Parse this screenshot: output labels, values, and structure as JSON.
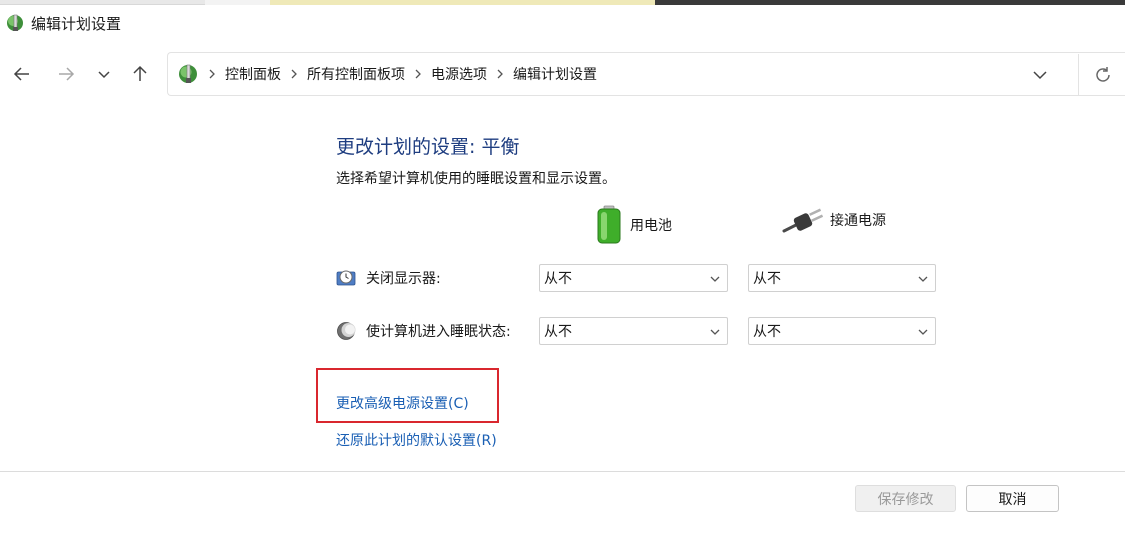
{
  "window": {
    "title": "编辑计划设置",
    "icon": "power-options-icon"
  },
  "nav": {
    "back_icon": "arrow-left-icon",
    "forward_icon": "arrow-right-icon",
    "recent_icon": "chevron-down-icon",
    "up_icon": "arrow-up-icon"
  },
  "breadcrumb": {
    "items": [
      "控制面板",
      "所有控制面板项",
      "电源选项",
      "编辑计划设置"
    ]
  },
  "main": {
    "heading": "更改计划的设置: 平衡",
    "subtext": "选择希望计算机使用的睡眠设置和显示设置。",
    "columns": {
      "battery": "用电池",
      "plugged": "接通电源"
    },
    "rows": [
      {
        "label": "关闭显示器:",
        "battery_value": "从不",
        "plugged_value": "从不"
      },
      {
        "label": "使计算机进入睡眠状态:",
        "battery_value": "从不",
        "plugged_value": "从不"
      }
    ],
    "links": {
      "advanced": "更改高级电源设置(C)",
      "restore": "还原此计划的默认设置(R)"
    }
  },
  "footer": {
    "save_label": "保存修改",
    "cancel_label": "取消"
  },
  "colors": {
    "heading": "#1e3d80",
    "link": "#1a5fb4",
    "highlight": "#d9272e"
  }
}
